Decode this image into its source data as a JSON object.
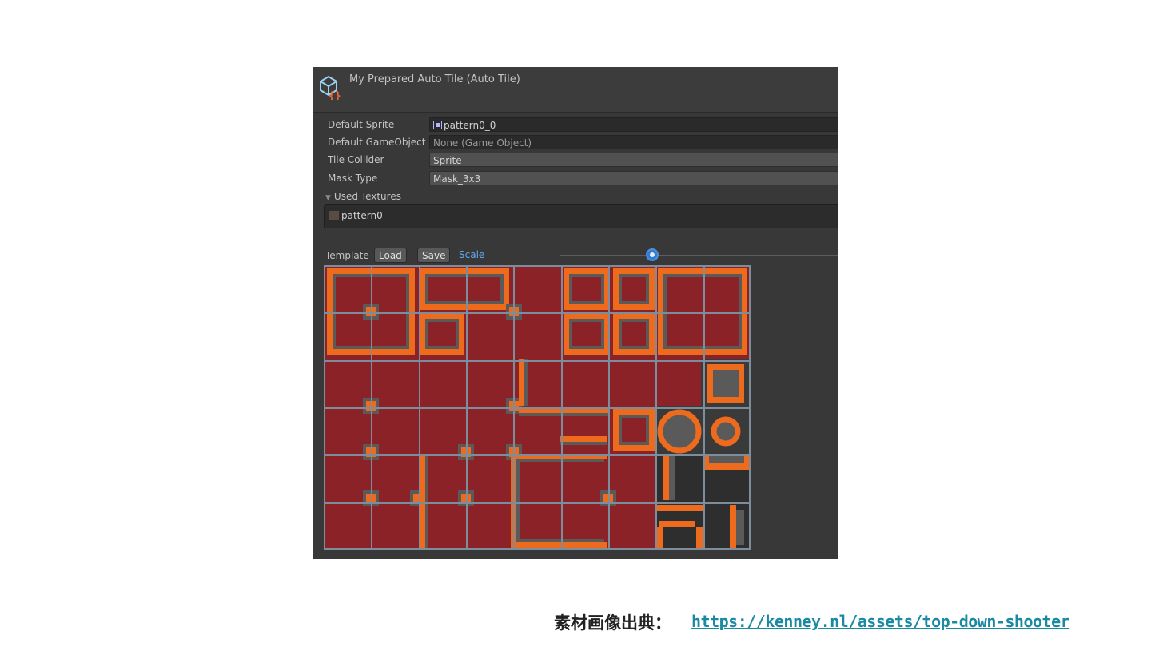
{
  "header": {
    "title": "My Prepared Auto Tile (Auto Tile)",
    "icon": "tile-asset-icon"
  },
  "properties": [
    {
      "label": "Default Sprite",
      "value": "pattern0_0",
      "kind": "object",
      "icon": "sprite-icon"
    },
    {
      "label": "Default GameObject",
      "value": "None (Game Object)",
      "kind": "object"
    },
    {
      "label": "Tile Collider",
      "value": "Sprite",
      "kind": "enum"
    },
    {
      "label": "Mask Type",
      "value": "Mask_3x3",
      "kind": "enum"
    }
  ],
  "used_textures": {
    "label": "Used Textures",
    "items": [
      "pattern0"
    ],
    "icon": "texture-icon"
  },
  "toolbar": {
    "template_label": "Template",
    "load_label": "Load",
    "save_label": "Save",
    "scale_label": "Scale"
  },
  "scale_slider": {
    "value_fraction": 0.32
  },
  "tile_grid": {
    "columns": 9,
    "rows": 6
  },
  "colors": {
    "floor": "#8b2227",
    "border": "#ee6a1c",
    "wall": "#5a5a5a",
    "grid": "#7d8d9c"
  },
  "credit": {
    "label": "素材画像出典：",
    "link": "https://kenney.nl/assets/top-down-shooter"
  }
}
